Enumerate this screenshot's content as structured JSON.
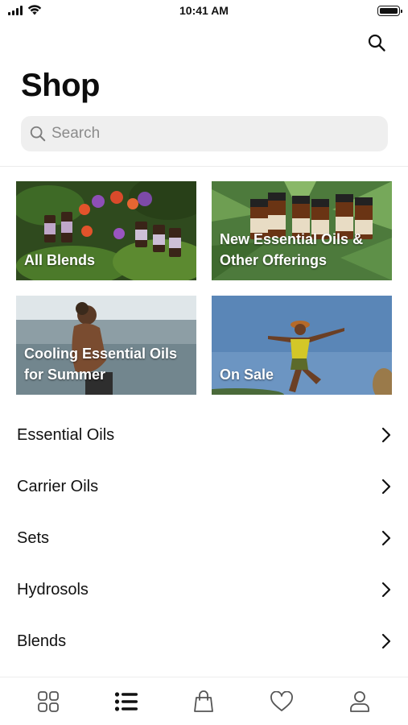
{
  "status_bar": {
    "time": "10:41 AM"
  },
  "header": {
    "title": "Shop",
    "search_icon": "search-icon"
  },
  "search": {
    "placeholder": "Search"
  },
  "tiles": [
    {
      "label": "All Blends"
    },
    {
      "label_line1": "New Essential Oils &",
      "label_line2": "Other Offerings"
    },
    {
      "label_line1": "Cooling Essential Oils",
      "label_line2": "for Summer"
    },
    {
      "label": "On Sale"
    }
  ],
  "categories": [
    {
      "label": "Essential Oils"
    },
    {
      "label": "Carrier Oils"
    },
    {
      "label": "Sets"
    },
    {
      "label": "Hydrosols"
    },
    {
      "label": "Blends"
    }
  ],
  "tabbar": {
    "items": [
      "grid-icon",
      "list-icon",
      "bag-icon",
      "heart-icon",
      "profile-icon"
    ],
    "active": "list-icon"
  },
  "colors": {
    "text": "#111111",
    "search_bg": "#efefef",
    "placeholder": "#8b8b8b"
  }
}
